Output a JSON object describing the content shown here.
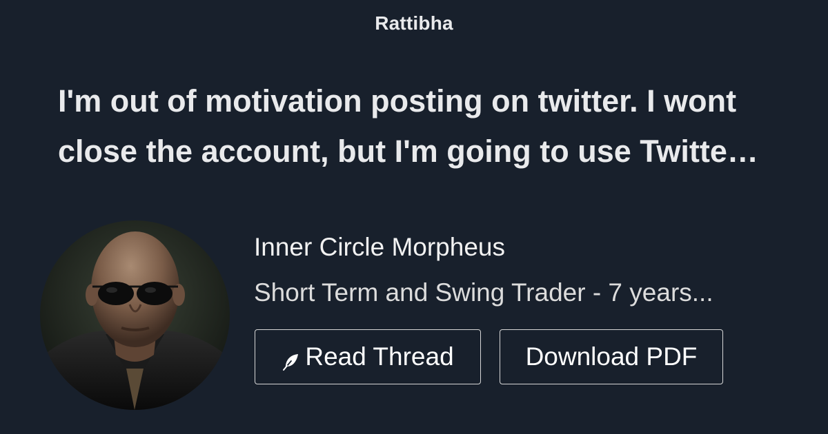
{
  "brand": "Rattibha",
  "thread": {
    "title": "I'm out of motivation posting on twitter. I wont close the account, but I'm going to use Twitte…"
  },
  "author": {
    "name": "Inner Circle Morpheus",
    "bio": "Short Term and Swing Trader - 7 years..."
  },
  "buttons": {
    "read_thread": "Read Thread",
    "download_pdf": "Download PDF"
  },
  "icons": {
    "read_thread": "feather-icon"
  },
  "colors": {
    "background": "#18202c",
    "text": "#e9eaec",
    "button_border": "#d8d8d8"
  }
}
